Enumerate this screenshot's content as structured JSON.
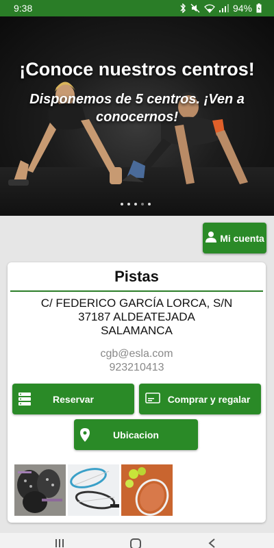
{
  "status_bar": {
    "time": "9:38",
    "battery": "94%"
  },
  "hero": {
    "headline": "¡Conoce nuestros centros!",
    "subline": "Disponemos de 5 centros. ¡Ven a conocernos!",
    "slide_count": 5,
    "active_slide": 4
  },
  "account_button": {
    "label": "Mi cuenta",
    "icon": "person-icon"
  },
  "card": {
    "title": "Pistas",
    "address": [
      "C/ FEDERICO GARCÍA LORCA, S/N",
      "37187 ALDEATEJADA",
      "SALAMANCA"
    ],
    "email": "cgb@esla.com",
    "phone": "923210413",
    "buttons": {
      "reservar": "Reservar",
      "comprar": "Comprar y regalar",
      "ubicacion": "Ubicacion"
    }
  },
  "colors": {
    "brand_green": "#2a8a27",
    "status_green": "#2a7d27"
  }
}
